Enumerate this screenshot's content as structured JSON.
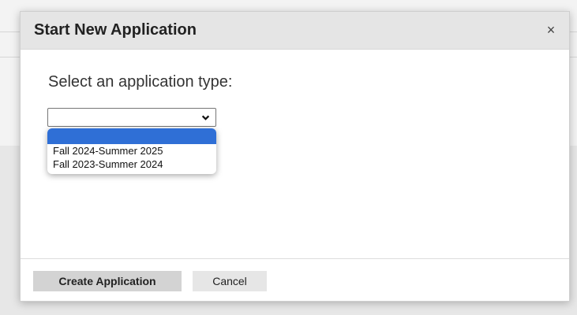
{
  "modal": {
    "title": "Start New Application",
    "close_label": "×",
    "prompt": "Select an application type:",
    "select": {
      "selected_value": "",
      "options": [
        "",
        "Fall 2024-Summer 2025",
        "Fall 2023-Summer 2024"
      ]
    },
    "footer": {
      "create_label": "Create Application",
      "cancel_label": "Cancel"
    }
  },
  "colors": {
    "header_bg": "#e5e5e5",
    "highlight": "#2f6fd6",
    "primary_button": "#d3d3d3",
    "secondary_button": "#e6e6e6"
  },
  "icons": [
    "close-icon",
    "chevron-down-icon"
  ]
}
